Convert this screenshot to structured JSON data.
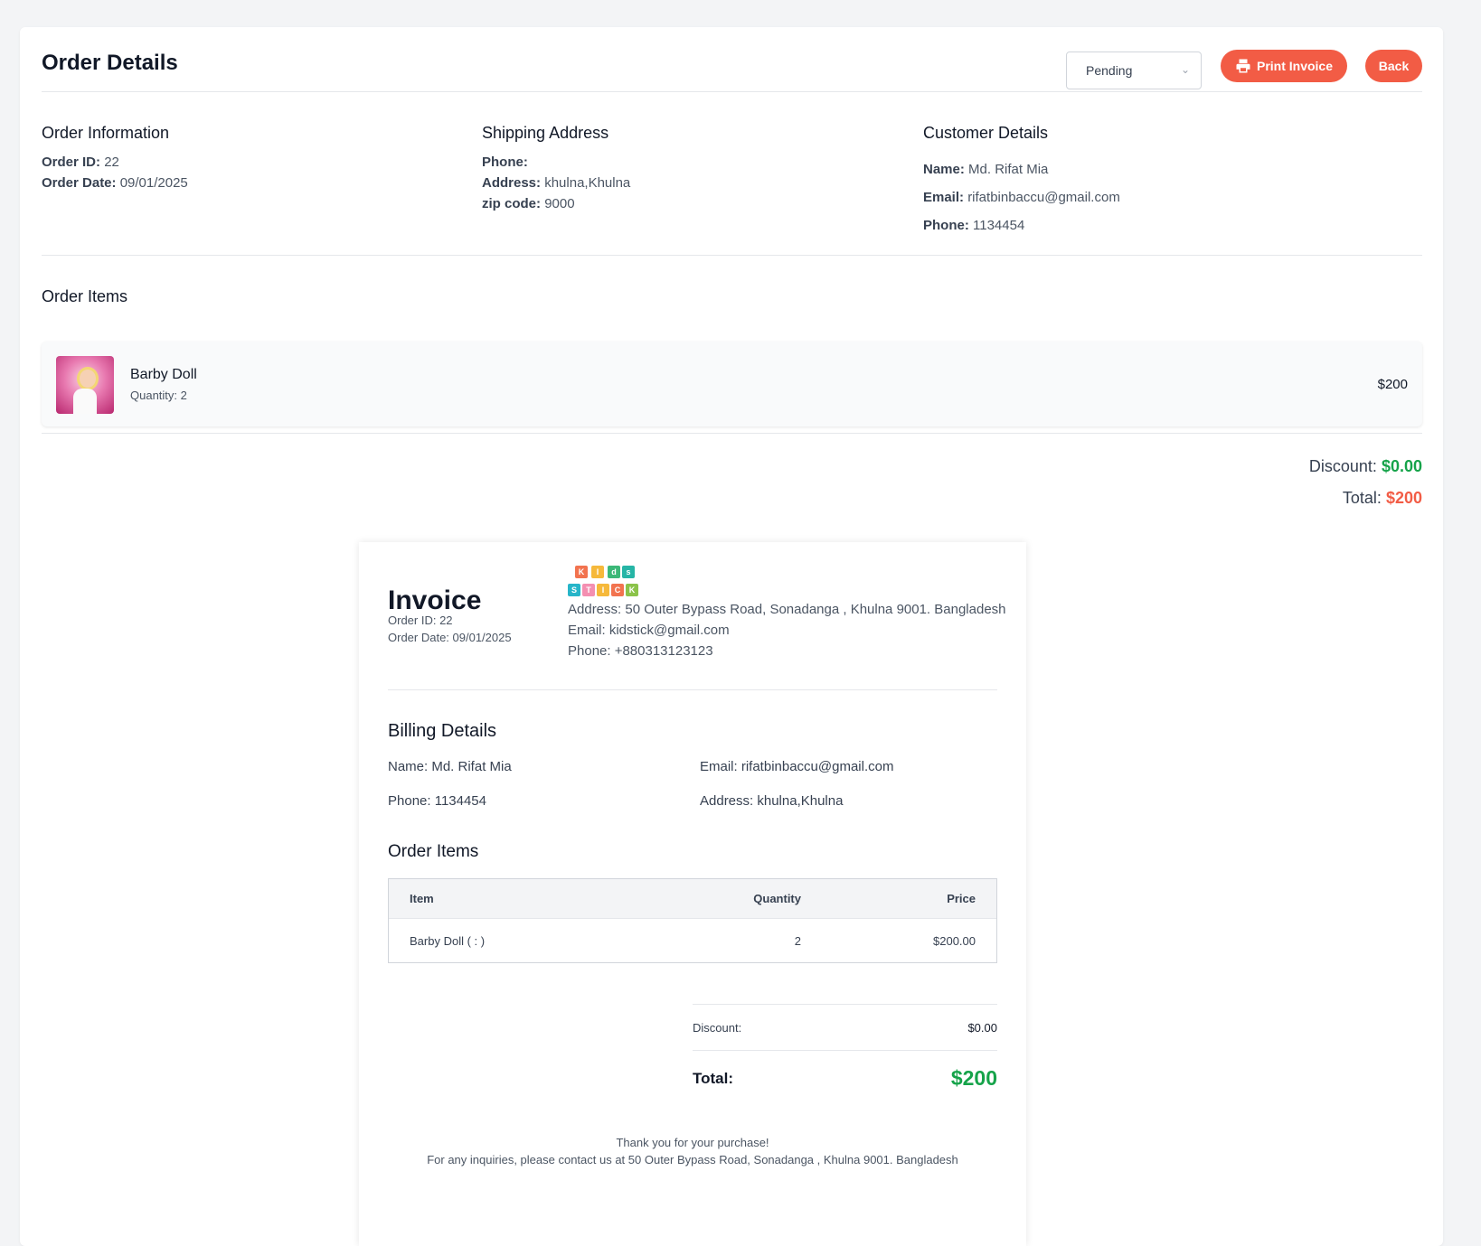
{
  "header": {
    "title": "Order Details",
    "status_value": "Pending",
    "print_label": "Print Invoice",
    "back_label": "Back"
  },
  "order_info": {
    "title": "Order Information",
    "order_id_label": "Order ID:",
    "order_id": "22",
    "order_date_label": "Order Date:",
    "order_date": "09/01/2025"
  },
  "shipping": {
    "title": "Shipping Address",
    "phone_label": "Phone:",
    "phone": "",
    "address_label": "Address:",
    "address": "khulna,Khulna",
    "zip_label": "zip code:",
    "zip": "9000"
  },
  "customer": {
    "title": "Customer Details",
    "name_label": "Name:",
    "name": "Md. Rifat Mia",
    "email_label": "Email:",
    "email": "rifatbinbaccu@gmail.com",
    "phone_label": "Phone:",
    "phone": "1134454"
  },
  "order_items": {
    "title": "Order Items",
    "items": [
      {
        "name": "Barby Doll",
        "quantity_text": "Quantity: 2",
        "price": "$200"
      }
    ]
  },
  "summary": {
    "discount_label": "Discount:",
    "discount": "$0.00",
    "total_label": "Total:",
    "total": "$200"
  },
  "invoice": {
    "title": "Invoice",
    "order_id_text": "Order ID: 22",
    "order_date_text": "Order Date: 09/01/2025",
    "logo_letters": [
      "K",
      "I",
      "d",
      "s",
      "S",
      "T",
      "I",
      "C",
      "K"
    ],
    "company_address": "Address: 50 Outer Bypass Road, Sonadanga , Khulna 9001. Bangladesh",
    "company_email": "Email: kidstick@gmail.com",
    "company_phone": "Phone: +880313123123",
    "billing_title": "Billing Details",
    "billing_name": "Name: Md. Rifat Mia",
    "billing_email": "Email: rifatbinbaccu@gmail.com",
    "billing_phone": "Phone: 1134454",
    "billing_address": "Address: khulna,Khulna",
    "items_title": "Order Items",
    "table": {
      "headers": [
        "Item",
        "Quantity",
        "Price"
      ],
      "rows": [
        [
          "Barby Doll ( : )",
          "2",
          "$200.00"
        ]
      ]
    },
    "discount_label": "Discount:",
    "discount": "$0.00",
    "total_label": "Total:",
    "total": "$200",
    "footer_line1": "Thank you for your purchase!",
    "footer_line2": "For any inquiries, please contact us at 50 Outer Bypass Road, Sonadanga , Khulna 9001. Bangladesh"
  },
  "colors": {
    "accent": "#f25c45",
    "discount_green": "#16a34a",
    "logo_tiles": [
      "#f2734f",
      "#f6b93b",
      "#3cb878",
      "#26b5a6",
      "#27b5c9",
      "#f48fb1",
      "#f6b93b",
      "#f2734f",
      "#8bc34a"
    ]
  }
}
